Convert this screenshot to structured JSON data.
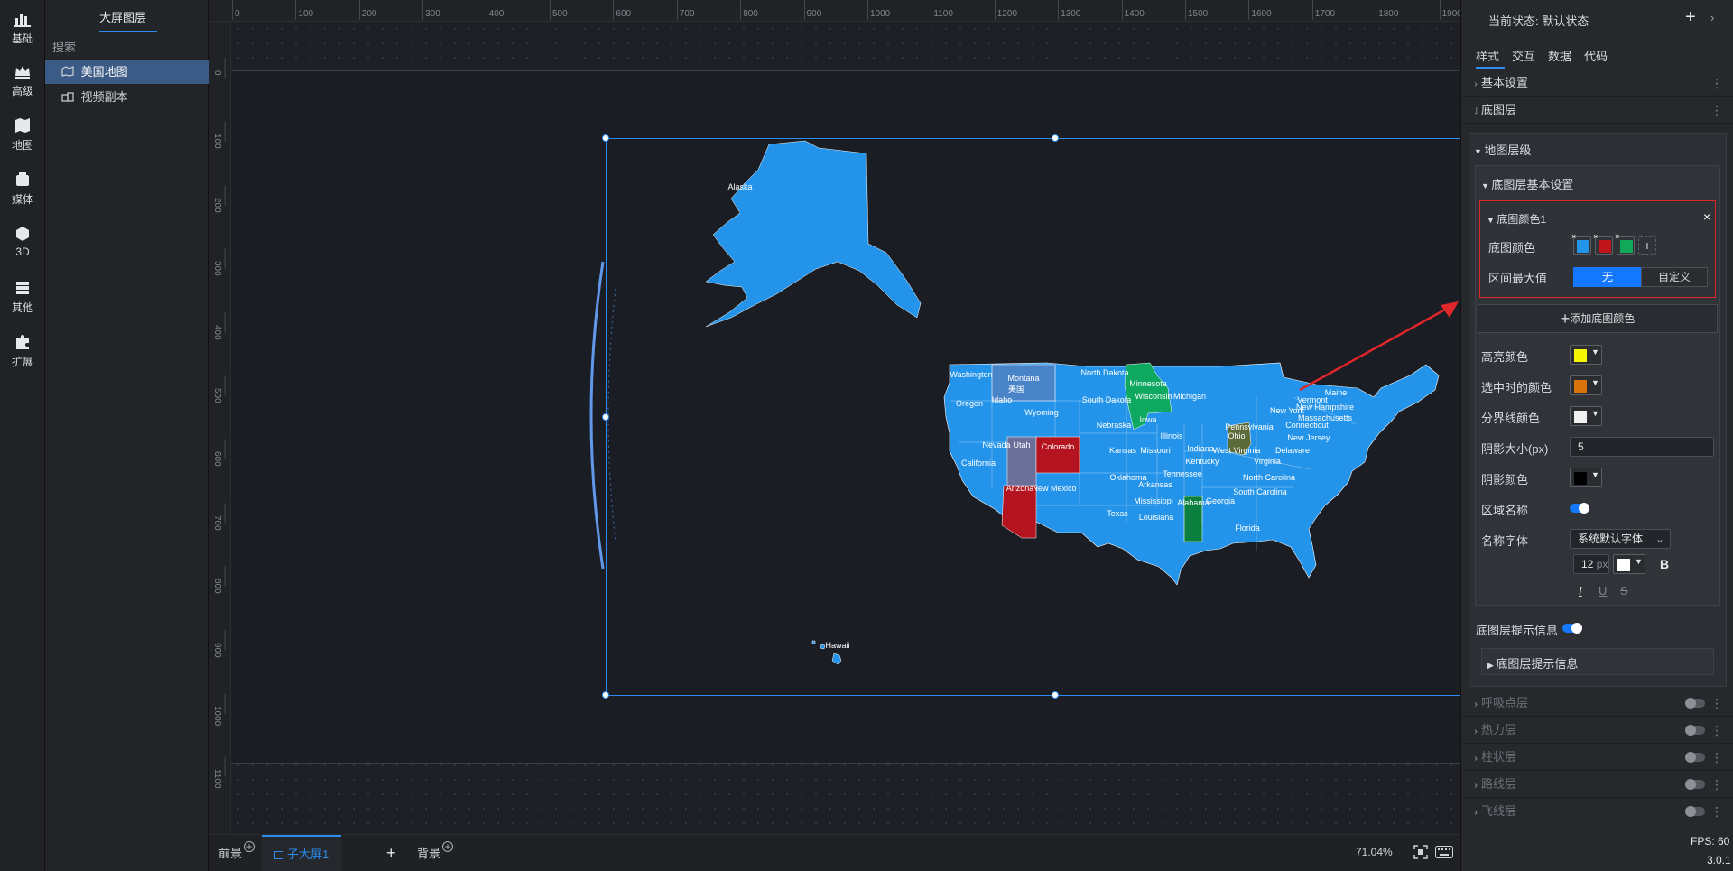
{
  "toolbar": {
    "items": [
      {
        "label": "基础",
        "icon": "bar-chart-icon"
      },
      {
        "label": "高级",
        "icon": "crown-icon"
      },
      {
        "label": "地图",
        "icon": "map-icon"
      },
      {
        "label": "媒体",
        "icon": "media-icon"
      },
      {
        "label": "3D",
        "icon": "cube-icon"
      },
      {
        "label": "其他",
        "icon": "stack-icon"
      },
      {
        "label": "扩展",
        "icon": "puzzle-icon"
      }
    ]
  },
  "layers": {
    "title": "大屏图层",
    "search_placeholder": "搜索",
    "items": [
      {
        "label": "美国地图",
        "active": true
      },
      {
        "label": "视频副本",
        "active": false
      }
    ]
  },
  "ruler": {
    "top": [
      "0",
      "100",
      "200",
      "300",
      "400",
      "500",
      "600",
      "700",
      "800",
      "900",
      "1000",
      "1100",
      "1200",
      "1300",
      "1400",
      "1500",
      "1600",
      "1700",
      "1800",
      "1900"
    ],
    "left": [
      "0",
      "100",
      "200",
      "300",
      "400",
      "500",
      "600",
      "700",
      "800",
      "900",
      "1000",
      "1100"
    ]
  },
  "map": {
    "colors": {
      "base": "#2394ea",
      "red": "#b3141f",
      "green": "#0ea860",
      "olive": "#5c6b3a",
      "muted": "#6b6f9a",
      "steel": "#4a84c8"
    },
    "labels": [
      "Alaska",
      "Hawaii",
      "Washington",
      "Montana",
      "North Dakota",
      "Minnesota",
      "Oregon",
      "Idaho",
      "South Dakota",
      "Wisconsin",
      "Michigan",
      "Wyoming",
      "Nebraska",
      "Iowa",
      "Nevada",
      "Utah",
      "Colorado",
      "Kansas",
      "Illinois",
      "Missouri",
      "California",
      "Arizona",
      "New Mexico",
      "Oklahoma",
      "Texas",
      "Arkansas",
      "Mississippi",
      "Alabama",
      "Louisiana",
      "Tennessee",
      "Kentucky",
      "Indiana",
      "Ohio",
      "Pennsylvania",
      "New York",
      "Vermont",
      "Maine",
      "New Hampshire",
      "Massachusetts",
      "Connecticut",
      "New Jersey",
      "Delaware",
      "Virginia",
      "West Virginia",
      "North Carolina",
      "South Carolina",
      "Georgia",
      "Florida",
      "美国"
    ]
  },
  "bottom": {
    "tab_front": "前景",
    "tab_active": "子大屏1",
    "tab_bg": "背景",
    "zoom": "71.04%"
  },
  "panel": {
    "state_label": "当前状态:  默认状态",
    "tabs": [
      "样式",
      "交互",
      "数据",
      "代码"
    ],
    "sections": {
      "basic": "基本设置",
      "base_layer": "底图层",
      "map_level": "地图层级",
      "base_basic": "底图层基本设置",
      "base_color1": "底图颜色1"
    },
    "color1": {
      "base_color_label": "底图颜色",
      "swatches": [
        "#2394ea",
        "#c0141c",
        "#12a85a"
      ],
      "range_label": "区间最大值",
      "range_none": "无",
      "range_custom": "自定义"
    },
    "add_color": "添加底图颜色",
    "props": {
      "highlight_label": "高亮颜色",
      "highlight_color": "#f5f500",
      "selected_label": "选中时的颜色",
      "selected_color": "#d9740c",
      "border_label": "分界线颜色",
      "border_color": "#f0f0f0",
      "shadow_size_label": "阴影大小(px)",
      "shadow_size": "5",
      "shadow_color_label": "阴影颜色",
      "shadow_color": "#000000",
      "region_name_label": "区域名称",
      "name_font_label": "名称字体",
      "font_value": "系统默认字体",
      "font_size": "12",
      "font_unit": "px",
      "font_color": "#ffffff",
      "bold": "B",
      "italic": "I",
      "underline": "U",
      "strike": "S"
    },
    "tooltip_toggle_label": "底图层提示信息",
    "tooltip_section": "底图层提示信息",
    "dim_layers": [
      "呼吸点层",
      "热力层",
      "柱状层",
      "路线层",
      "飞线层"
    ],
    "fps": "FPS: 60",
    "version": "3.0.1"
  }
}
